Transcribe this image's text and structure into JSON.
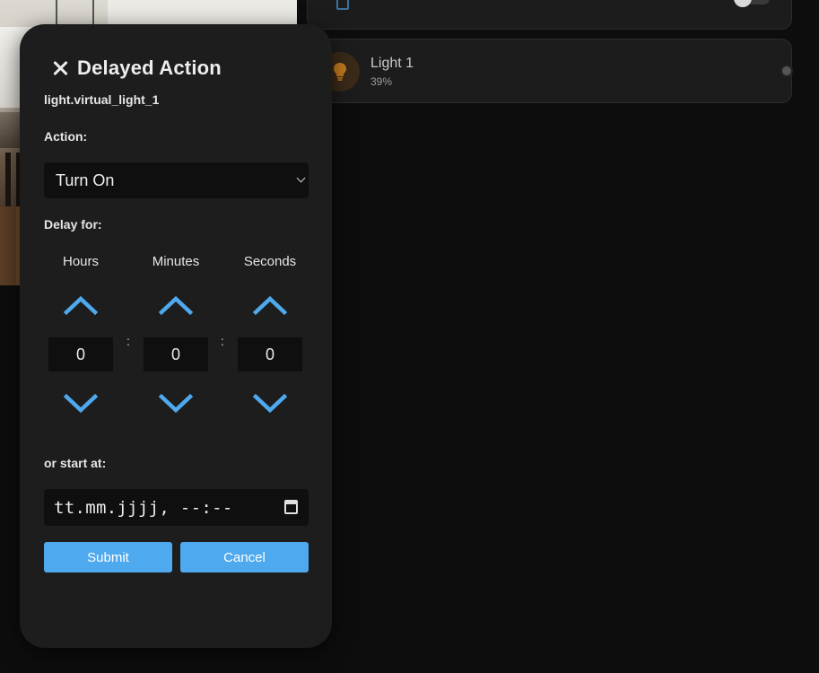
{
  "background": {
    "light_card": {
      "name": "Light 1",
      "state": "39%"
    }
  },
  "dialog": {
    "title": "Delayed Action",
    "entity_id": "light.virtual_light_1",
    "action_label": "Action:",
    "action_value": "Turn On",
    "delay_label": "Delay for:",
    "columns": [
      {
        "label": "Hours",
        "value": "0"
      },
      {
        "label": "Minutes",
        "value": "0"
      },
      {
        "label": "Seconds",
        "value": "0"
      }
    ],
    "separator": ":",
    "start_label": "or start at:",
    "datetime_placeholder": "tt.mm.jjjj, --:--",
    "submit_label": "Submit",
    "cancel_label": "Cancel"
  },
  "colors": {
    "accent": "#4ea9ee",
    "arrow": "#4ea9ee",
    "light_icon": "#c27a1e",
    "dialog_bg": "#1d1d1d"
  }
}
